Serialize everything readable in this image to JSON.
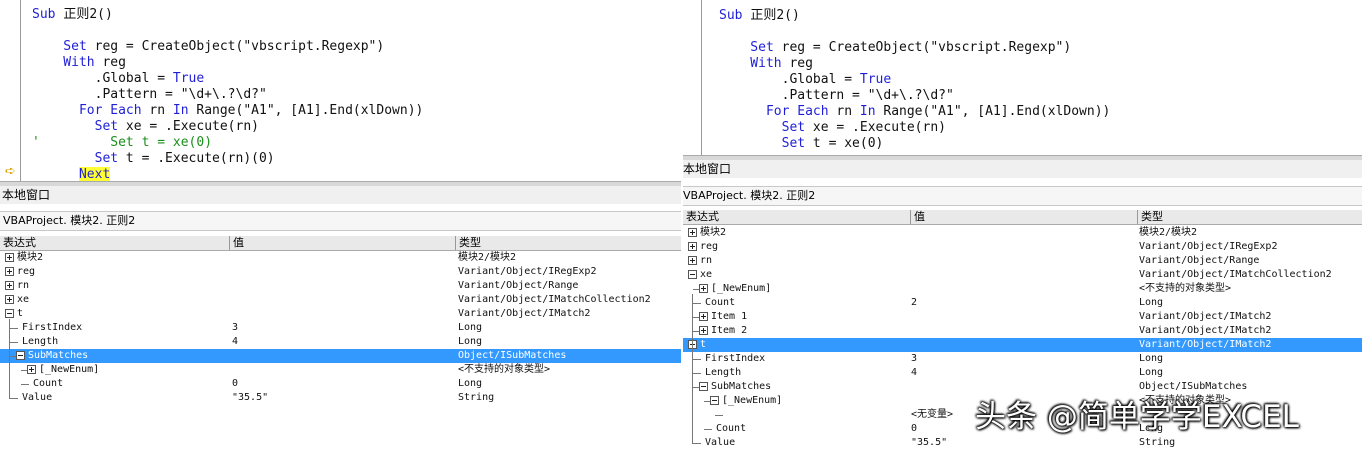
{
  "left": {
    "code_lines": [
      [
        {
          "t": "Sub ",
          "c": "kw"
        },
        {
          "t": "正则2()",
          "c": ""
        }
      ],
      [],
      [
        {
          "t": "    Set ",
          "c": "kw"
        },
        {
          "t": "reg = CreateObject(\"vbscript.Regexp\")",
          "c": ""
        }
      ],
      [
        {
          "t": "    With ",
          "c": "kw"
        },
        {
          "t": "reg",
          "c": ""
        }
      ],
      [
        {
          "t": "        .Global = ",
          "c": ""
        },
        {
          "t": "True",
          "c": "kw"
        }
      ],
      [
        {
          "t": "        .Pattern = \"\\d+\\.?\\d?\"",
          "c": ""
        }
      ],
      [
        {
          "t": "      For Each ",
          "c": "kw"
        },
        {
          "t": "rn ",
          "c": ""
        },
        {
          "t": "In ",
          "c": "kw"
        },
        {
          "t": "Range(\"A1\", [A1].End(xlDown))",
          "c": ""
        }
      ],
      [
        {
          "t": "        Set ",
          "c": "kw"
        },
        {
          "t": "xe = .Execute(rn)",
          "c": ""
        }
      ],
      [
        {
          "t": "'",
          "c": "cm"
        },
        {
          "t": "         Set t = xe(0)",
          "c": "cm"
        }
      ],
      [
        {
          "t": "        Set ",
          "c": "kw"
        },
        {
          "t": "t = .Execute(rn)(0)",
          "c": ""
        }
      ],
      [
        {
          "t": "      ",
          "c": ""
        },
        {
          "t": "Next",
          "c": "kw hl"
        }
      ]
    ],
    "title": "本地窗口",
    "context": "VBAProject. 模块2. 正则2",
    "headers": [
      "表达式",
      "值",
      "类型"
    ],
    "rows": [
      {
        "indent": 0,
        "box": "plus",
        "expr": "模块2",
        "val": "",
        "type": "模块2/模块2"
      },
      {
        "indent": 0,
        "box": "plus",
        "expr": "reg",
        "val": "",
        "type": "Variant/Object/IRegExp2"
      },
      {
        "indent": 0,
        "box": "plus",
        "expr": "rn",
        "val": "",
        "type": "Variant/Object/Range"
      },
      {
        "indent": 0,
        "box": "plus",
        "expr": "xe",
        "val": "",
        "type": "Variant/Object/IMatchCollection2"
      },
      {
        "indent": 0,
        "box": "minus",
        "expr": "t",
        "val": "",
        "type": "Variant/Object/IMatch2"
      },
      {
        "indent": 1,
        "box": "",
        "expr": "FirstIndex",
        "val": "3",
        "type": "Long"
      },
      {
        "indent": 1,
        "box": "",
        "expr": "Length",
        "val": "4",
        "type": "Long"
      },
      {
        "indent": 1,
        "box": "minus",
        "expr": "SubMatches",
        "val": "",
        "type": "Object/ISubMatches",
        "sel": true
      },
      {
        "indent": 2,
        "box": "plus",
        "expr": "[_NewEnum]",
        "val": "",
        "type": "<不支持的对象类型>"
      },
      {
        "indent": 2,
        "box": "",
        "expr": "Count",
        "val": "0",
        "type": "Long"
      },
      {
        "indent": 1,
        "box": "",
        "expr": "Value",
        "val": "\"35.5\"",
        "type": "String"
      }
    ]
  },
  "right": {
    "code_lines": [
      [
        {
          "t": "Sub ",
          "c": "kw"
        },
        {
          "t": "正则2()",
          "c": ""
        }
      ],
      [],
      [
        {
          "t": "    Set ",
          "c": "kw"
        },
        {
          "t": "reg = CreateObject(\"vbscript.Regexp\")",
          "c": ""
        }
      ],
      [
        {
          "t": "    With ",
          "c": "kw"
        },
        {
          "t": "reg",
          "c": ""
        }
      ],
      [
        {
          "t": "        .Global = ",
          "c": ""
        },
        {
          "t": "True",
          "c": "kw"
        }
      ],
      [
        {
          "t": "        .Pattern = \"\\d+\\.?\\d?\"",
          "c": ""
        }
      ],
      [
        {
          "t": "      For Each ",
          "c": "kw"
        },
        {
          "t": "rn ",
          "c": ""
        },
        {
          "t": "In ",
          "c": "kw"
        },
        {
          "t": "Range(\"A1\", [A1].End(xlDown))",
          "c": ""
        }
      ],
      [
        {
          "t": "        Set ",
          "c": "kw"
        },
        {
          "t": "xe = .Execute(rn)",
          "c": ""
        }
      ],
      [
        {
          "t": "        Set ",
          "c": "kw"
        },
        {
          "t": "t = xe(0)",
          "c": ""
        }
      ]
    ],
    "title": "本地窗口",
    "context": "VBAProject. 模块2. 正则2",
    "headers": [
      "表达式",
      "值",
      "类型"
    ],
    "rows": [
      {
        "indent": 0,
        "box": "plus",
        "expr": "模块2",
        "val": "",
        "type": "模块2/模块2"
      },
      {
        "indent": 0,
        "box": "plus",
        "expr": "reg",
        "val": "",
        "type": "Variant/Object/IRegExp2"
      },
      {
        "indent": 0,
        "box": "plus",
        "expr": "rn",
        "val": "",
        "type": "Variant/Object/Range"
      },
      {
        "indent": 0,
        "box": "minus",
        "expr": "xe",
        "val": "",
        "type": "Variant/Object/IMatchCollection2"
      },
      {
        "indent": 1,
        "box": "plus",
        "expr": "[_NewEnum]",
        "val": "",
        "type": "<不支持的对象类型>"
      },
      {
        "indent": 1,
        "box": "",
        "expr": "Count",
        "val": "2",
        "type": "Long"
      },
      {
        "indent": 1,
        "box": "plus",
        "expr": "Item 1",
        "val": "",
        "type": "Variant/Object/IMatch2"
      },
      {
        "indent": 1,
        "box": "plus",
        "expr": "Item 2",
        "val": "",
        "type": "Variant/Object/IMatch2"
      },
      {
        "indent": 0,
        "box": "minus",
        "expr": "t",
        "val": "",
        "type": "Variant/Object/IMatch2",
        "sel": true
      },
      {
        "indent": 1,
        "box": "",
        "expr": "FirstIndex",
        "val": "3",
        "type": "Long"
      },
      {
        "indent": 1,
        "box": "",
        "expr": "Length",
        "val": "4",
        "type": "Long"
      },
      {
        "indent": 1,
        "box": "minus",
        "expr": "SubMatches",
        "val": "",
        "type": "Object/ISubMatches"
      },
      {
        "indent": 2,
        "box": "minus",
        "expr": "[_NewEnum]",
        "val": "",
        "type": "<不支持的对象类型>"
      },
      {
        "indent": 3,
        "box": "",
        "expr": "",
        "val": "<无变量>",
        "type": ""
      },
      {
        "indent": 2,
        "box": "",
        "expr": "Count",
        "val": "0",
        "type": "Long"
      },
      {
        "indent": 1,
        "box": "",
        "expr": "Value",
        "val": "\"35.5\"",
        "type": "String"
      }
    ]
  },
  "watermark": "头条 @简单学学EXCEL"
}
